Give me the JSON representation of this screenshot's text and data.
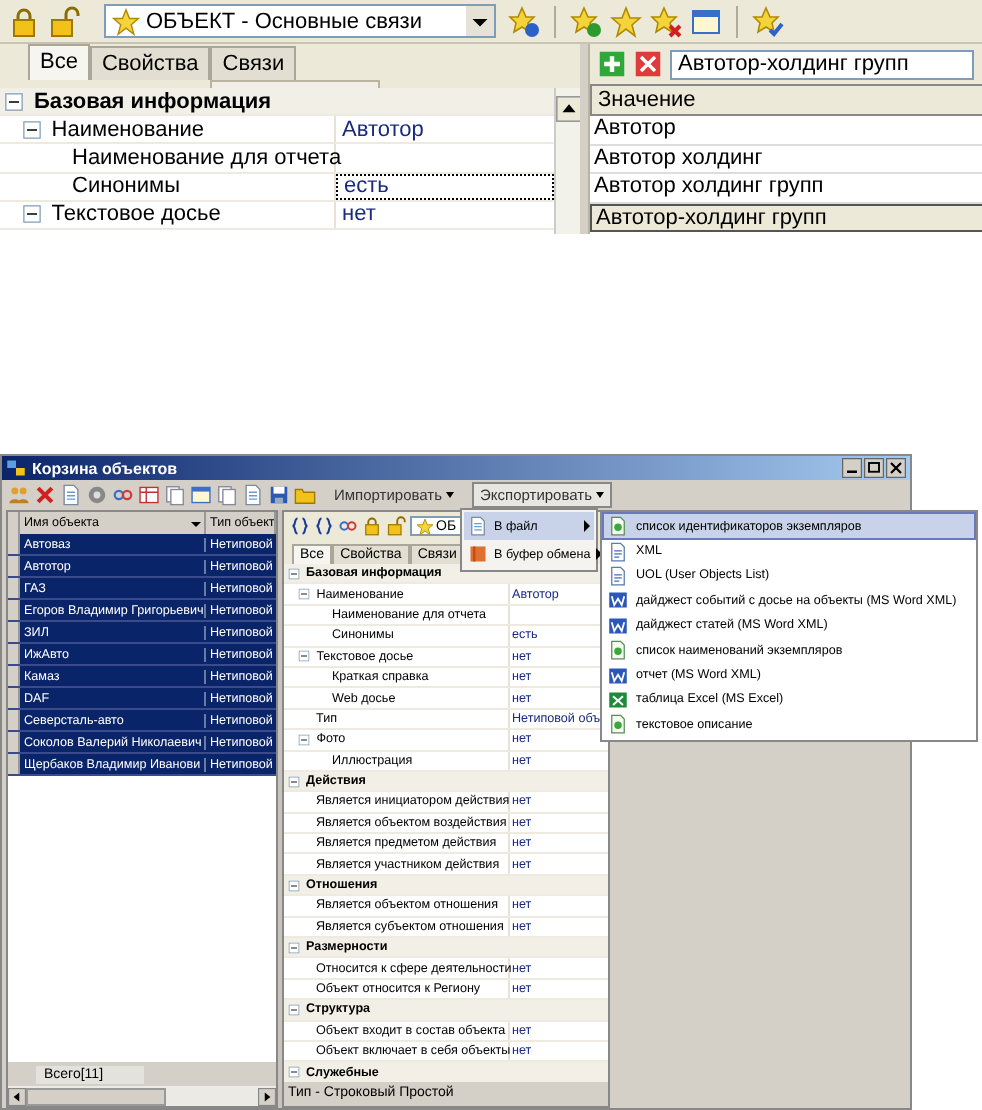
{
  "editor": {
    "object_selector": "ОБЪЕКТ - Основные связи",
    "tabs": [
      {
        "label": "Все",
        "selected": true
      },
      {
        "label": "Свойства",
        "selected": false
      },
      {
        "label": "Связи",
        "selected": false
      }
    ],
    "properties": [
      {
        "label": "Базовая информация",
        "expanded": true,
        "children": [
          {
            "label": "Наименование",
            "value": "Автотор",
            "expanded": true,
            "selected": false,
            "children": [
              {
                "label": "Наименование для отчета",
                "selected": false
              },
              {
                "label": "Синонимы",
                "value": "есть",
                "selected": true
              }
            ]
          },
          {
            "label": "Текстовое досье",
            "value": "нет",
            "expanded": true,
            "selected": false
          }
        ]
      }
    ],
    "values_panel": {
      "input": "Автотор-холдинг групп",
      "header": "Значение",
      "rows": [
        {
          "text": "Автотор",
          "selected": false
        },
        {
          "text": "Автотор холдинг",
          "selected": false
        },
        {
          "text": "Автотор холдинг групп",
          "selected": false
        },
        {
          "text": "Автотор-холдинг групп",
          "selected": true
        }
      ]
    }
  },
  "basket_window": {
    "title": "Корзина объектов",
    "toolbar_menus": [
      {
        "label": "Импортировать",
        "open": false
      },
      {
        "label": "Экспортировать",
        "open": true
      }
    ],
    "list": {
      "columns": [
        "Имя объекта",
        "Тип объект"
      ],
      "rows": [
        {
          "name": "Автоваз",
          "type": "Нетиповой",
          "selected": true
        },
        {
          "name": "Автотор",
          "type": "Нетиповой",
          "selected": true
        },
        {
          "name": "ГАЗ",
          "type": "Нетиповой",
          "selected": true
        },
        {
          "name": "Егоров Владимир Григорьевич",
          "type": "Нетиповой",
          "selected": true
        },
        {
          "name": "ЗИЛ",
          "type": "Нетиповой",
          "selected": true
        },
        {
          "name": "ИжАвто",
          "type": "Нетиповой",
          "selected": true
        },
        {
          "name": "Камаз",
          "type": "Нетиповой",
          "selected": true
        },
        {
          "name": "DAF",
          "type": "Нетиповой",
          "selected": true
        },
        {
          "name": "Северсталь-авто",
          "type": "Нетиповой",
          "selected": true
        },
        {
          "name": "Соколов Валерий Николаевич",
          "type": "Нетиповой",
          "selected": true
        },
        {
          "name": "Щербаков Владимир Иванови",
          "type": "Нетиповой",
          "selected": true
        }
      ],
      "total": "Всего[11]"
    },
    "inspector": {
      "object_selector": "ОБ",
      "tabs": [
        {
          "label": "Все",
          "selected": true
        },
        {
          "label": "Свойства",
          "selected": false
        },
        {
          "label": "Связи",
          "selected": false
        }
      ],
      "properties": [
        {
          "label": "Базовая информация",
          "expanded": true,
          "children": [
            {
              "label": "Наименование",
              "value": "Автотор",
              "expanded": true,
              "children": [
                {
                  "label": "Наименование для отчета"
                },
                {
                  "label": "Синонимы",
                  "value": "есть"
                }
              ]
            },
            {
              "label": "Текстовое досье",
              "value": "нет",
              "expanded": true,
              "children": [
                {
                  "label": "Краткая справка",
                  "value": "нет"
                },
                {
                  "label": "Web досье",
                  "value": "нет"
                }
              ]
            },
            {
              "label": "Тип",
              "value": "Нетиповой объ"
            },
            {
              "label": "Фото",
              "value": "нет",
              "expanded": true,
              "children": [
                {
                  "label": "Иллюстрация",
                  "value": "нет"
                }
              ]
            }
          ]
        },
        {
          "label": "Действия",
          "expanded": true,
          "children": [
            {
              "label": "Является инициатором действия",
              "value": "нет"
            },
            {
              "label": "Является объектом воздействия",
              "value": "нет"
            },
            {
              "label": "Является предметом действия",
              "value": "нет"
            },
            {
              "label": "Является участником действия",
              "value": "нет"
            }
          ]
        },
        {
          "label": "Отношения",
          "expanded": true,
          "children": [
            {
              "label": "Является объектом отношения",
              "value": "нет"
            },
            {
              "label": "Является субъектом отношения",
              "value": "нет"
            }
          ]
        },
        {
          "label": "Размерности",
          "expanded": true,
          "children": [
            {
              "label": "Относится к сфере деятельности",
              "value": "нет"
            },
            {
              "label": "Объект относится к Региону",
              "value": "нет"
            }
          ]
        },
        {
          "label": "Структура",
          "expanded": true,
          "children": [
            {
              "label": "Объект входит в состав объекта",
              "value": "нет"
            },
            {
              "label": "Объект включает в себя объекты",
              "value": "нет"
            }
          ]
        },
        {
          "label": "Служебные",
          "expanded": true
        }
      ],
      "status": "Тип - Строковый Простой"
    },
    "export_menu": [
      {
        "label": "В файл",
        "selected": true
      },
      {
        "label": "В буфер обмена",
        "selected": false
      }
    ],
    "file_submenu": [
      {
        "label": "список идентификаторов экземпляров",
        "kind": "list",
        "selected": true
      },
      {
        "label": "XML",
        "kind": "xml",
        "selected": false
      },
      {
        "label": "UOL (User Objects List)",
        "kind": "xml",
        "selected": false
      },
      {
        "label": "дайджест событий с досье на объекты (MS Word XML)",
        "kind": "word",
        "selected": false
      },
      {
        "label": "дайджест статей (MS Word XML)",
        "kind": "word",
        "selected": false
      },
      {
        "label": "список наименований экземпляров",
        "kind": "list",
        "selected": false
      },
      {
        "label": "отчет (MS Word XML)",
        "kind": "word",
        "selected": false
      },
      {
        "label": "таблица Excel (MS Excel)",
        "kind": "excel",
        "selected": false
      },
      {
        "label": "текстовое описание",
        "kind": "list",
        "selected": false
      }
    ]
  }
}
